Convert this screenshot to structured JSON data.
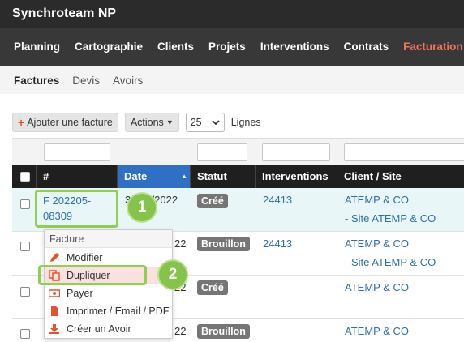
{
  "app": {
    "title": "Synchroteam NP"
  },
  "nav": {
    "items": [
      "Planning",
      "Cartographie",
      "Clients",
      "Projets",
      "Interventions",
      "Contrats",
      "Facturation"
    ],
    "active": "Facturation"
  },
  "subnav": {
    "items": [
      "Factures",
      "Devis",
      "Avoirs"
    ],
    "active": "Factures"
  },
  "toolbar": {
    "add_invoice": "Ajouter une facture",
    "actions": "Actions",
    "rows_per_page": "25",
    "rows_label": "Lignes"
  },
  "table": {
    "headers": [
      "#",
      "Date",
      "Statut",
      "Interventions",
      "Client / Site"
    ],
    "sorted_column": "Date",
    "rows": [
      {
        "number_line1": "F 202205-",
        "number_line2": "08309",
        "date": "31/05/2022",
        "status": "Créé",
        "intervention": "24413",
        "client": "ATEMP & CO",
        "site": "- Site ATEMP & CO"
      },
      {
        "date_tail": "22",
        "status": "Brouillon",
        "intervention": "24413",
        "client": "ATEMP & CO",
        "site": "- Site ATEMP & CO"
      },
      {
        "date_tail": "22",
        "status": "Créé",
        "client": "ATEMP & CO"
      },
      {
        "date_tail": "22",
        "status": "Brouillon",
        "client": "ATEMP & CO"
      }
    ]
  },
  "context_menu": {
    "header": "Facture",
    "items": [
      "Modifier",
      "Dupliquer",
      "Payer",
      "Imprimer / Email / PDF",
      "Créer un Avoir"
    ],
    "highlighted": "Dupliquer"
  },
  "markers": [
    "1",
    "2"
  ],
  "colors": {
    "topbar": "#2b2b2b",
    "nav": "#383838",
    "active_nav": "#f0735d",
    "sorted_header": "#2f6fc4",
    "link": "#2f6fa8",
    "callout": "#86c34a",
    "highlight": "#fbe0e0",
    "icon_red": "#e4552f"
  }
}
